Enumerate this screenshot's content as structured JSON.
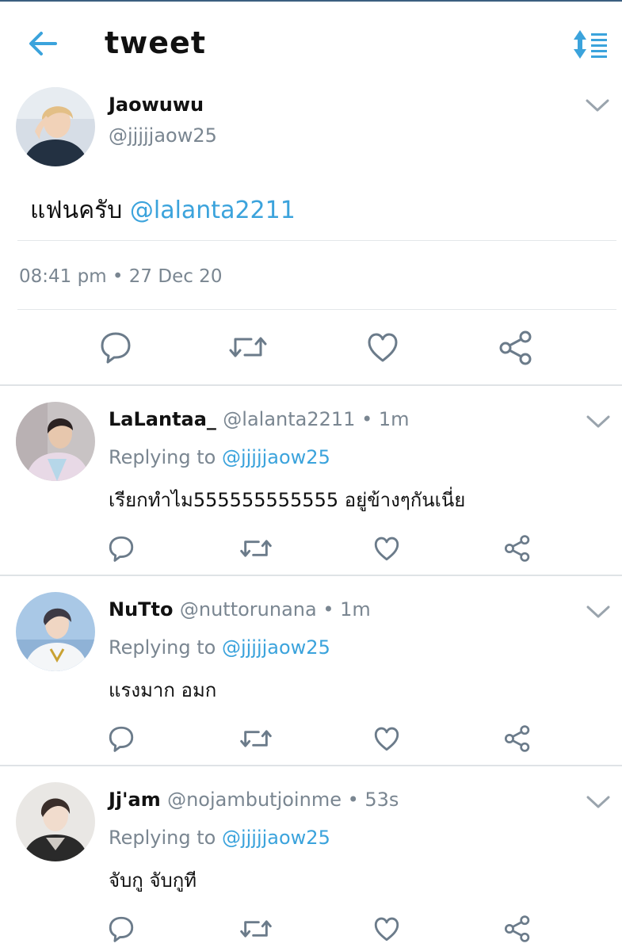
{
  "header": {
    "title": "tweet"
  },
  "tweet": {
    "author_name": "Jaowuwu",
    "author_handle": "@jjjjjaow25",
    "text": "แฟนครับ ",
    "mention": "@lalanta2211",
    "datetime": "08:41 pm • 27 Dec 20"
  },
  "replies": [
    {
      "name": "LaLantaa_",
      "handle": "@lalanta2211 • 1m",
      "replying_prefix": "Replying to ",
      "replying_to": "@jjjjjaow25",
      "text": "เรียกทำไม555555555555 อยู่ข้างๆกันเนี่ย"
    },
    {
      "name": "NuTto",
      "handle": "@nuttorunana • 1m",
      "replying_prefix": "Replying to ",
      "replying_to": "@jjjjjaow25",
      "text": "แรงมาก อมก"
    },
    {
      "name": "Jj'am",
      "handle": "@nojambutjoinme • 53s",
      "replying_prefix": "Replying to ",
      "replying_to": "@jjjjjaow25",
      "text": "จับกู จับกูที"
    }
  ],
  "colors": {
    "accent": "#3ba3dc",
    "muted": "#7a8691",
    "icon": "#6b7b8a",
    "divider": "#e4e7ea"
  },
  "icons": [
    "back-arrow-icon",
    "sort-icon",
    "chevron-down-icon",
    "reply-icon",
    "retweet-icon",
    "like-icon",
    "share-icon"
  ]
}
